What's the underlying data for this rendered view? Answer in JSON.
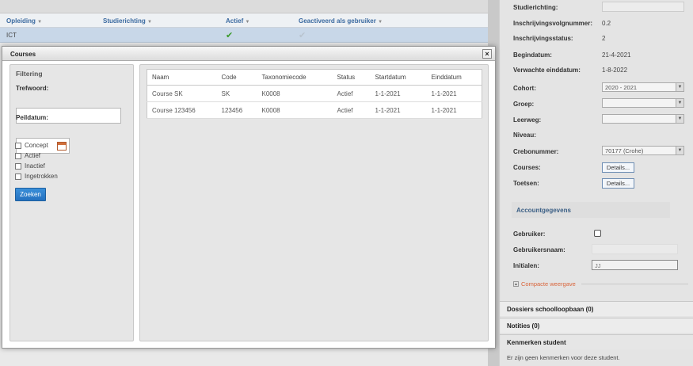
{
  "grid": {
    "headers": [
      "Opleiding",
      "Studierichting",
      "Actief",
      "Geactiveerd als gebruiker"
    ],
    "rows": [
      {
        "opleiding": "ICT",
        "studierichting": "",
        "actief": "✔",
        "geactiveerd": "✔"
      }
    ]
  },
  "student": {
    "fields": [
      {
        "label": "Studierichting:",
        "value": ""
      },
      {
        "label": "Inschrijvingsvolgnummer:",
        "value": "0.2"
      },
      {
        "label": "Inschrijvingsstatus:",
        "value": "2"
      },
      {
        "label": "Begindatum:",
        "value": "21-4-2021"
      },
      {
        "label": "Verwachte einddatum:",
        "value": "1-8-2022"
      }
    ],
    "cohort": {
      "label": "Cohort:",
      "value": "2020 - 2021"
    },
    "groep": {
      "label": "Groep:",
      "value": ""
    },
    "leerweg": {
      "label": "Leerweg:",
      "value": ""
    },
    "niveau": {
      "label": "Niveau:"
    },
    "crebo": {
      "label": "Crebonummer:",
      "value": "70177 (Crohe)"
    },
    "courses": {
      "label": "Courses:",
      "button": "Details..."
    },
    "toetsen": {
      "label": "Toetsen:",
      "button": "Details..."
    },
    "account_title": "Accountgegevens",
    "gebruiker": {
      "label": "Gebruiker:"
    },
    "gebruikersnaam": {
      "label": "Gebruikersnaam:",
      "value": ""
    },
    "initialen": {
      "label": "Initialen:",
      "value": "JJ"
    },
    "compact_link": "Compacte weergave"
  },
  "sections": [
    {
      "label": "Dossiers schoolloopbaan (0)"
    },
    {
      "label": "Notities (0)"
    },
    {
      "label": "Kenmerken student"
    }
  ],
  "kenmerken_empty": "Er zijn geen kenmerken voor deze student.",
  "modal": {
    "title": "Courses",
    "close": "×",
    "filter": {
      "title": "Filtering",
      "trefwoord_label": "Trefwoord:",
      "peildatum_label": "Peildatum:",
      "checkboxes": [
        "Concept",
        "Actief",
        "Inactief",
        "Ingetrokken"
      ],
      "search_button": "Zoeken"
    },
    "table": {
      "headers": [
        "Naam",
        "Code",
        "Taxonomiecode",
        "Status",
        "Startdatum",
        "Einddatum"
      ],
      "rows": [
        [
          "Course SK",
          "SK",
          "K0008",
          "Actief",
          "1-1-2021",
          "1-1-2021"
        ],
        [
          "Course 123456",
          "123456",
          "K0008",
          "Actief",
          "1-1-2021",
          "1-1-2021"
        ]
      ]
    }
  },
  "colors": {
    "accent": "#2571c0",
    "check": "#3a9a2a",
    "link": "#d9643a",
    "header_text": "#3b6aa0"
  }
}
